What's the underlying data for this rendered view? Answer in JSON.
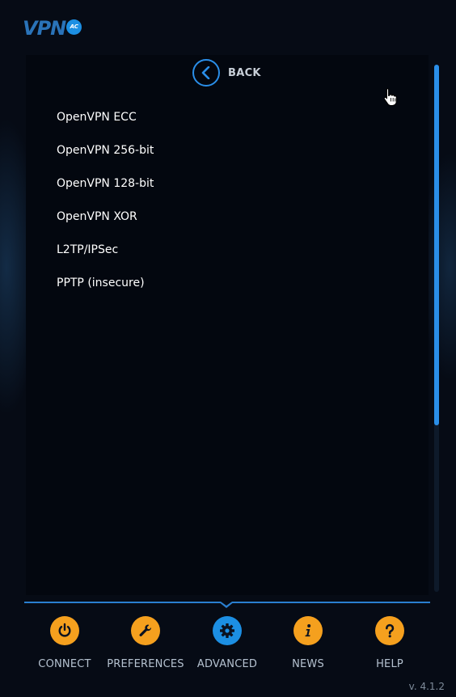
{
  "app": {
    "logo_text": "VPN",
    "logo_badge": "AC",
    "version": "v. 4.1.2",
    "accent_color": "#2a8ee8",
    "nav_icon_color": "#f5a01e"
  },
  "back": {
    "label": "BACK",
    "icon": "chevron-left-icon"
  },
  "protocols": [
    "OpenVPN ECC",
    "OpenVPN 256-bit",
    "OpenVPN 128-bit",
    "OpenVPN XOR",
    "L2TP/IPSec",
    "PPTP (insecure)"
  ],
  "nav": [
    {
      "label": "CONNECT",
      "icon": "power-icon",
      "active": false
    },
    {
      "label": "PREFERENCES",
      "icon": "wrench-icon",
      "active": false
    },
    {
      "label": "ADVANCED",
      "icon": "gear-icon",
      "active": true
    },
    {
      "label": "NEWS",
      "icon": "info-icon",
      "active": false
    },
    {
      "label": "HELP",
      "icon": "question-icon",
      "active": false
    }
  ]
}
